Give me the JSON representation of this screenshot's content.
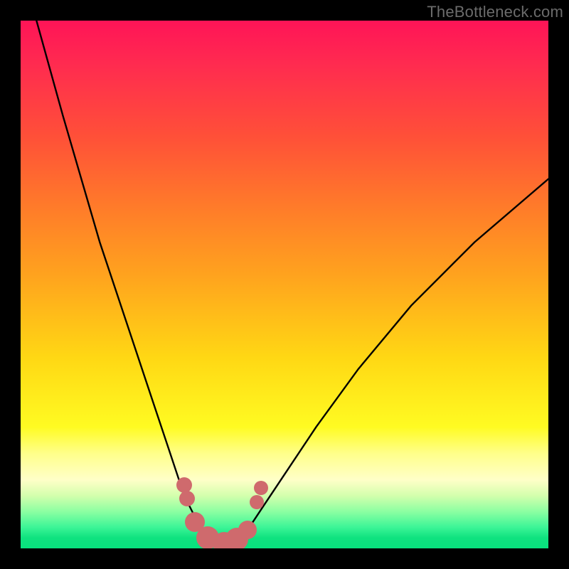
{
  "watermark": "TheBottleneck.com",
  "colors": {
    "background": "#000000",
    "gradient_top": "#ff1457",
    "gradient_mid": "#ffd814",
    "gradient_bottom": "#08e27e",
    "curve_stroke": "#000000",
    "dot_fill": "#cf6a6d"
  },
  "chart_data": {
    "type": "line",
    "title": "",
    "xlabel": "",
    "ylabel": "",
    "ylim": [
      0,
      100
    ],
    "xlim": [
      0,
      100
    ],
    "series": [
      {
        "name": "left",
        "x": [
          3,
          8,
          15,
          20,
          25,
          28,
          30,
          31.5,
          33,
          35,
          36.5,
          38
        ],
        "y": [
          100,
          82,
          58,
          43,
          28,
          19,
          13,
          9,
          6,
          3,
          1.5,
          0.5
        ]
      },
      {
        "name": "right",
        "x": [
          38,
          40,
          42,
          44,
          46,
          50,
          56,
          64,
          74,
          86,
          100
        ],
        "y": [
          0.5,
          1,
          2.5,
          5,
          8,
          14,
          23,
          34,
          46,
          58,
          70
        ]
      }
    ],
    "dots": {
      "name": "markers",
      "points": [
        {
          "x": 31.0,
          "y": 12.0,
          "r": 11
        },
        {
          "x": 31.5,
          "y": 9.5,
          "r": 11
        },
        {
          "x": 33.0,
          "y": 5.0,
          "r": 14
        },
        {
          "x": 35.5,
          "y": 2.0,
          "r": 16
        },
        {
          "x": 38.5,
          "y": 1.0,
          "r": 16
        },
        {
          "x": 41.0,
          "y": 1.7,
          "r": 16
        },
        {
          "x": 43.0,
          "y": 3.5,
          "r": 13
        },
        {
          "x": 44.7,
          "y": 8.7,
          "r": 10
        },
        {
          "x": 45.6,
          "y": 11.5,
          "r": 10
        }
      ]
    }
  }
}
